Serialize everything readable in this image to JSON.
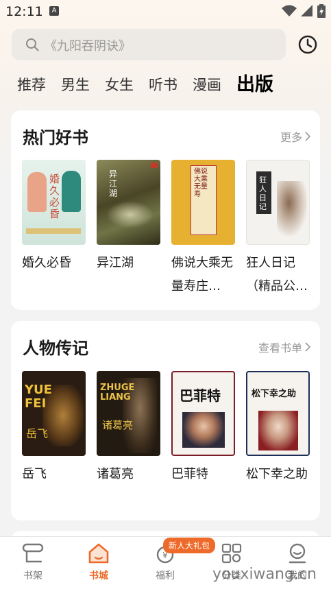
{
  "status": {
    "time": "12:11",
    "app_icon": "A"
  },
  "search": {
    "placeholder": "《九阳吞阴诀》"
  },
  "tabs": [
    "推荐",
    "男生",
    "女生",
    "听书",
    "漫画",
    "出版"
  ],
  "active_tab": "出版",
  "sections": [
    {
      "title": "热门好书",
      "more": "更多",
      "books": [
        {
          "title": "婚久必昏",
          "cover_text": "婚久必昏"
        },
        {
          "title": "异江湖",
          "cover_text": "异江湖"
        },
        {
          "title": "佛说大乘无量寿庄…",
          "cover_text": "佛说大乘无量寿"
        },
        {
          "title": "狂人日记（精品公…",
          "cover_text": "狂人日记"
        }
      ]
    },
    {
      "title": "人物传记",
      "more": "查看书单",
      "books": [
        {
          "title": "岳飞",
          "cover_text": "YUE FEI 岳飞"
        },
        {
          "title": "诸葛亮",
          "cover_text": "ZHUGE LIANG 诸葛亮"
        },
        {
          "title": "巴菲特",
          "cover_text": "巴菲特"
        },
        {
          "title": "松下幸之助",
          "cover_text": "松下幸之助"
        }
      ]
    }
  ],
  "bottom_nav": [
    {
      "label": "书架",
      "icon": "bookshelf-icon"
    },
    {
      "label": "书城",
      "icon": "bookstore-home-icon"
    },
    {
      "label": "福利",
      "icon": "coin-bag-icon"
    },
    {
      "label": "分类",
      "icon": "category-grid-icon"
    },
    {
      "label": "我的",
      "icon": "profile-face-icon"
    }
  ],
  "badge": "新人大礼包",
  "watermark": "youxiwang.cn",
  "colors": {
    "accent": "#ee6a2a",
    "background": "#f3f3f3",
    "card": "#ffffff"
  }
}
